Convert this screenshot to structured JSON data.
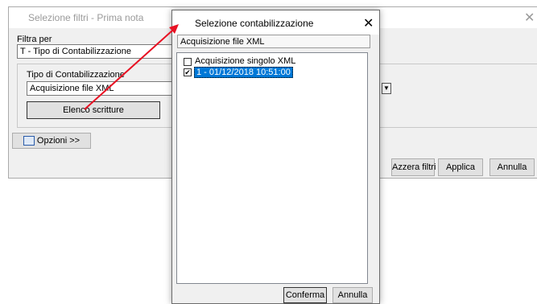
{
  "background_dialog": {
    "title": "Selezione filtri - Prima nota",
    "filter_label": "Filtra per",
    "filter_value": "T - Tipo di Contabilizzazione",
    "type_label": "Tipo di Contabilizzazione",
    "type_value": "Acquisizione file XML",
    "list_button": "Elenco scritture",
    "options_button": "Opzioni >>",
    "reset_button": "Azzera filtri",
    "apply_button": "Applica",
    "cancel_button": "Annulla"
  },
  "front_dialog": {
    "title": "Selezione contabilizzazione",
    "header_value": "Acquisizione file XML",
    "items": [
      {
        "label": "Acquisizione singolo XML",
        "checked": false
      },
      {
        "label": "1 - 01/12/2018 10:51:00",
        "checked": true,
        "selected": true
      }
    ],
    "confirm_button": "Conferma",
    "cancel_button": "Annulla"
  },
  "annotation": {
    "arrow_color": "#e81123"
  }
}
